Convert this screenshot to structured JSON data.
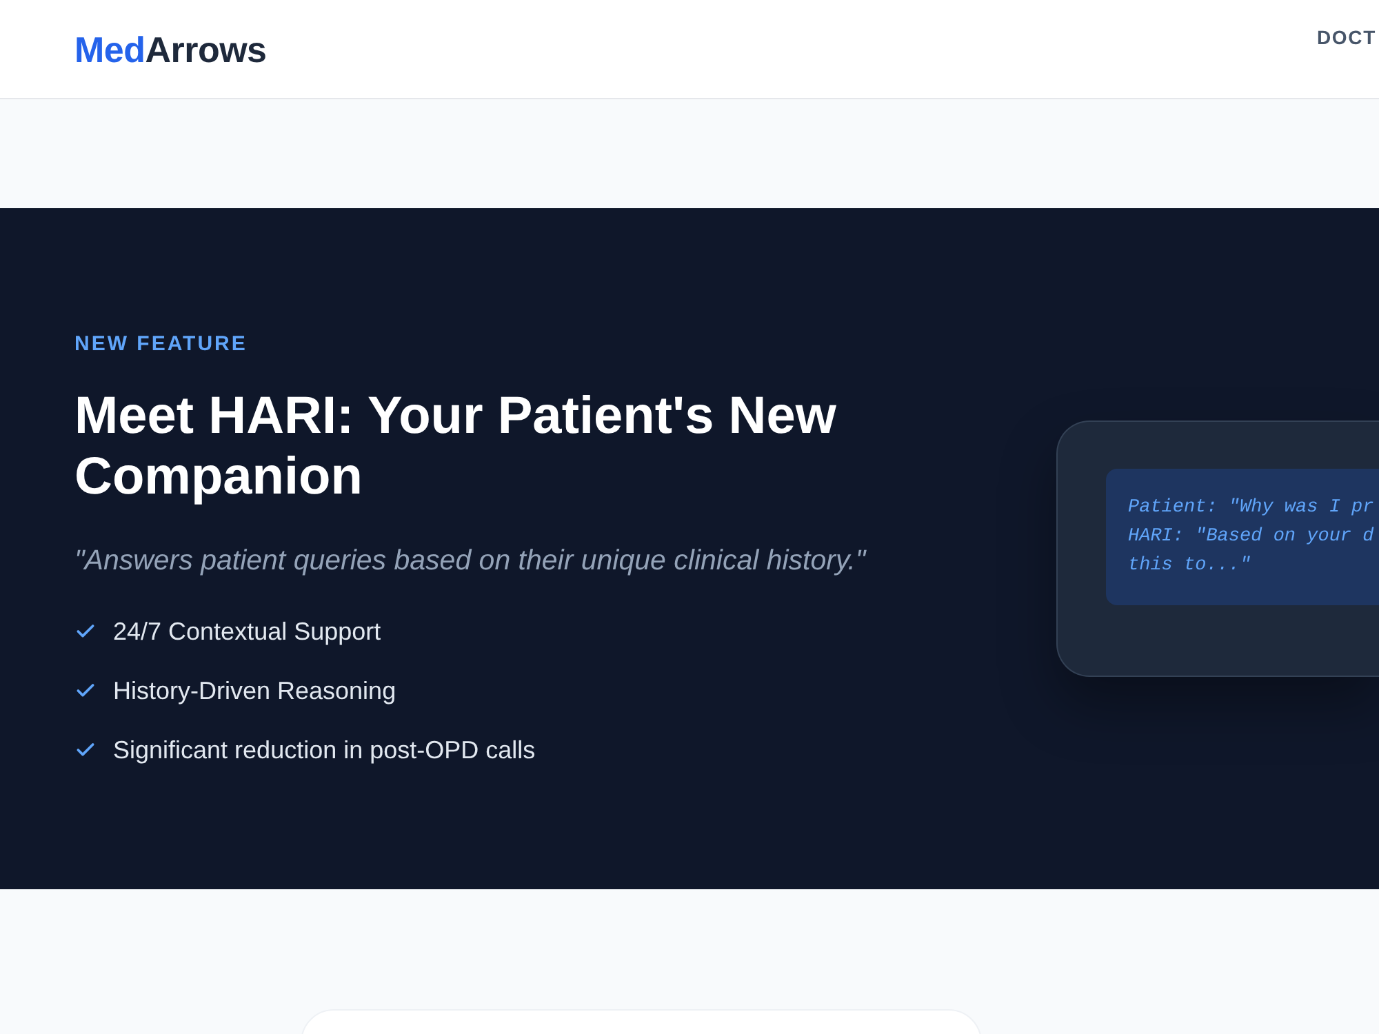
{
  "header": {
    "logo": {
      "part_1": "Med",
      "part_2": "Arrows"
    },
    "nav": [
      {
        "label": "DOCT"
      }
    ]
  },
  "hero": {
    "eyebrow": "NEW FEATURE",
    "title": "Meet HARI: Your Patient's New Companion",
    "quote": "\"Answers patient queries based on their unique clinical history.\"",
    "features": [
      {
        "label": "24/7 Contextual Support"
      },
      {
        "label": "History-Driven Reasoning"
      },
      {
        "label": "Significant reduction in post-OPD calls"
      }
    ],
    "chat_preview": {
      "lines": [
        "Patient: \"Why was I pr",
        "HARI: \"Based on your d",
        "this to...\""
      ]
    }
  }
}
